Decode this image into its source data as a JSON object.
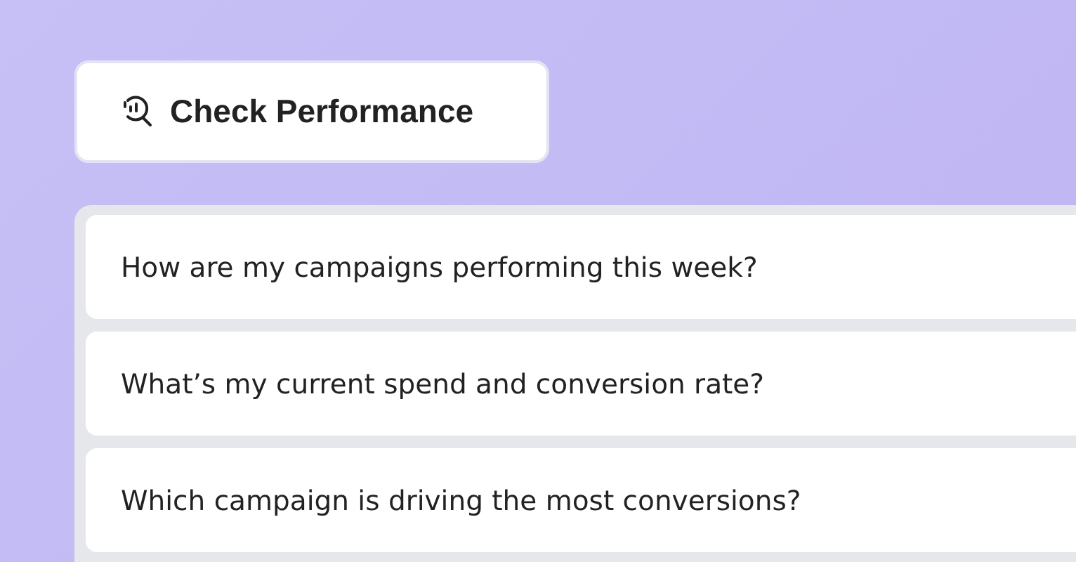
{
  "action_button": {
    "label": "Check Performance"
  },
  "suggestions": [
    {
      "text": "How are my campaigns performing this week?"
    },
    {
      "text": "What’s my current spend and conversion rate?"
    },
    {
      "text": "Which campaign is driving the most conversions?"
    }
  ]
}
